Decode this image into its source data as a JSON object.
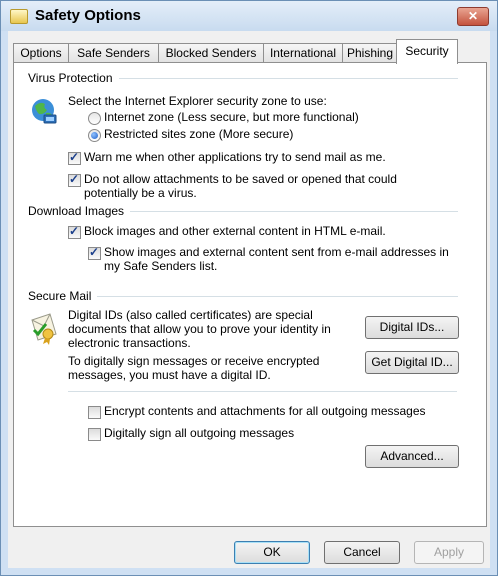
{
  "window": {
    "title": "Safety Options",
    "close_glyph": "✕"
  },
  "tabs": [
    {
      "label": "Options"
    },
    {
      "label": "Safe Senders"
    },
    {
      "label": "Blocked Senders"
    },
    {
      "label": "International"
    },
    {
      "label": "Phishing"
    },
    {
      "label": "Security",
      "active": true
    }
  ],
  "virus": {
    "group_label": "Virus Protection",
    "icon": "globe-icon",
    "intro": "Select the Internet Explorer security zone to use:",
    "zone_internet": "Internet zone (Less secure, but more functional)",
    "zone_restricted": "Restricted sites zone (More secure)",
    "selected_zone": "restricted",
    "warn_label": "Warn me when other applications try to send mail as me.",
    "warn_checked": true,
    "block_attach_line1": "Do not allow attachments to be saved or opened that could",
    "block_attach_line2": "potentially be a virus.",
    "block_attach_checked": true
  },
  "download": {
    "group_label": "Download Images",
    "block_images_label": "Block images and other external content in HTML e-mail.",
    "block_images_checked": true,
    "show_safe_line1": "Show images and external content sent from e-mail addresses in",
    "show_safe_line2": "my Safe Senders list.",
    "show_safe_checked": true
  },
  "secure_mail": {
    "group_label": "Secure Mail",
    "icon": "certificate-icon",
    "desc1_line1": "Digital IDs (also called certificates) are special",
    "desc1_line2": "documents that allow you to prove your identity in",
    "desc1_line3": "electronic transactions.",
    "desc2_line1": "To digitally sign messages or receive encrypted",
    "desc2_line2": "messages, you must have a digital ID.",
    "digital_ids_button": "Digital IDs...",
    "get_digital_id_button": "Get Digital ID...",
    "encrypt_label": "Encrypt contents and attachments for all outgoing messages",
    "encrypt_checked": false,
    "sign_label": "Digitally sign all outgoing messages",
    "sign_checked": false,
    "advanced_button": "Advanced..."
  },
  "footer": {
    "ok": "OK",
    "cancel": "Cancel",
    "apply": "Apply"
  }
}
